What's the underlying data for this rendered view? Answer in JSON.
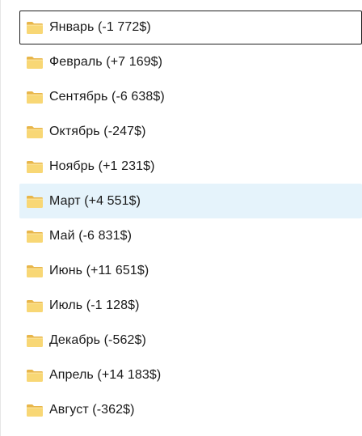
{
  "folders": {
    "items": [
      {
        "label": "Январь (-1 772$)"
      },
      {
        "label": "Февраль (+7 169$)"
      },
      {
        "label": "Сентябрь (-6 638$)"
      },
      {
        "label": "Октябрь (-247$)"
      },
      {
        "label": "Ноябрь (+1 231$)"
      },
      {
        "label": "Март (+4 551$)"
      },
      {
        "label": "Май (-6 831$)"
      },
      {
        "label": "Июнь (+11 651$)"
      },
      {
        "label": "Июль (-1 128$)"
      },
      {
        "label": "Декабрь (-562$)"
      },
      {
        "label": "Апрель (+14 183$)"
      },
      {
        "label": "Август (-362$)"
      }
    ],
    "icon": "folder-icon",
    "focused_index": 0,
    "hovered_index": 5
  },
  "colors": {
    "folder_body": "#f8d775",
    "folder_tab": "#e8b64a",
    "hover_background": "#e5f3fb",
    "focus_border": "#1f1f1f"
  }
}
